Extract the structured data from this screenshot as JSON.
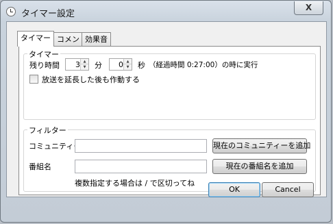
{
  "window": {
    "title": "タイマー設定",
    "close_symbol": "X"
  },
  "tabs": [
    {
      "label": "タイマー",
      "active": true
    },
    {
      "label": "コメント",
      "active": false
    },
    {
      "label": "効果音",
      "active": false
    }
  ],
  "timer_group": {
    "legend": "タイマー",
    "remaining_label": "残り時間",
    "minutes_value": "3",
    "minutes_unit": "分",
    "seconds_value": "0",
    "seconds_unit": "秒",
    "elapsed_text": "（経過時間 0:27:00）の時に実行",
    "extend_checkbox_label": "放送を延長した後も作動する",
    "extend_checked": false
  },
  "filter_group": {
    "legend": "フィルター",
    "community_label": "コミュニティー",
    "community_value": "",
    "add_community_button": "現在のコミュニティーを追加",
    "program_label": "番組名",
    "program_value": "",
    "add_program_button": "現在の番組名を追加",
    "hint": "複数指定する場合は / で区切ってね"
  },
  "footer": {
    "ok_label": "OK",
    "cancel_label": "Cancel"
  },
  "icons": {
    "title_icon": "clock-icon",
    "spin_up": "▲",
    "spin_down": "▼"
  }
}
